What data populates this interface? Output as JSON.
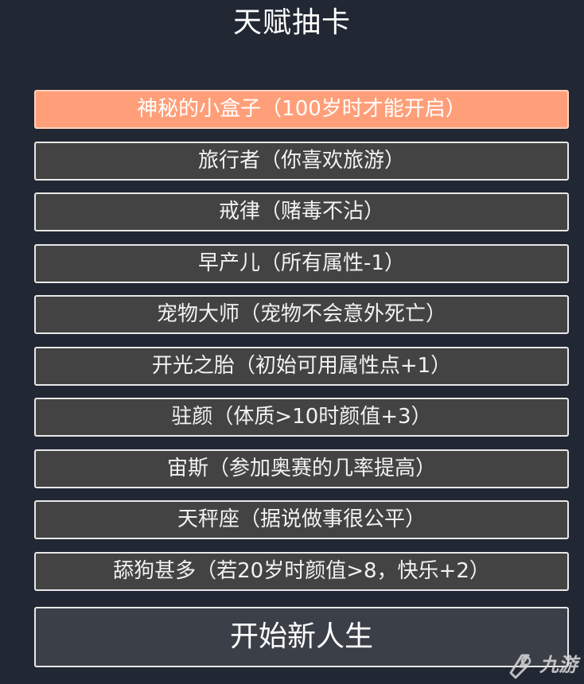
{
  "header": {
    "title": "天赋抽卡"
  },
  "talents": [
    {
      "label": "神秘的小盒子（100岁时才能开启）",
      "selected": true
    },
    {
      "label": "旅行者（你喜欢旅游）",
      "selected": false
    },
    {
      "label": "戒律（赌毒不沾）",
      "selected": false
    },
    {
      "label": "早产儿（所有属性-1）",
      "selected": false
    },
    {
      "label": "宠物大师（宠物不会意外死亡）",
      "selected": false
    },
    {
      "label": "开光之胎（初始可用属性点+1）",
      "selected": false
    },
    {
      "label": "驻颜（体质>10时颜值+3）",
      "selected": false
    },
    {
      "label": "宙斯（参加奥赛的几率提高）",
      "selected": false
    },
    {
      "label": "天秤座（据说做事很公平）",
      "selected": false
    },
    {
      "label": "舔狗甚多（若20岁时颜值>8，快乐+2）",
      "selected": false
    }
  ],
  "actions": {
    "start_label": "开始新人生"
  },
  "watermark": {
    "text": "九游",
    "icon": "jiuyou-logo-icon"
  },
  "colors": {
    "background": "#212733",
    "talent_bg": "#434343",
    "selected_bg": "#ff9f79",
    "border": "#e8e8e8"
  }
}
